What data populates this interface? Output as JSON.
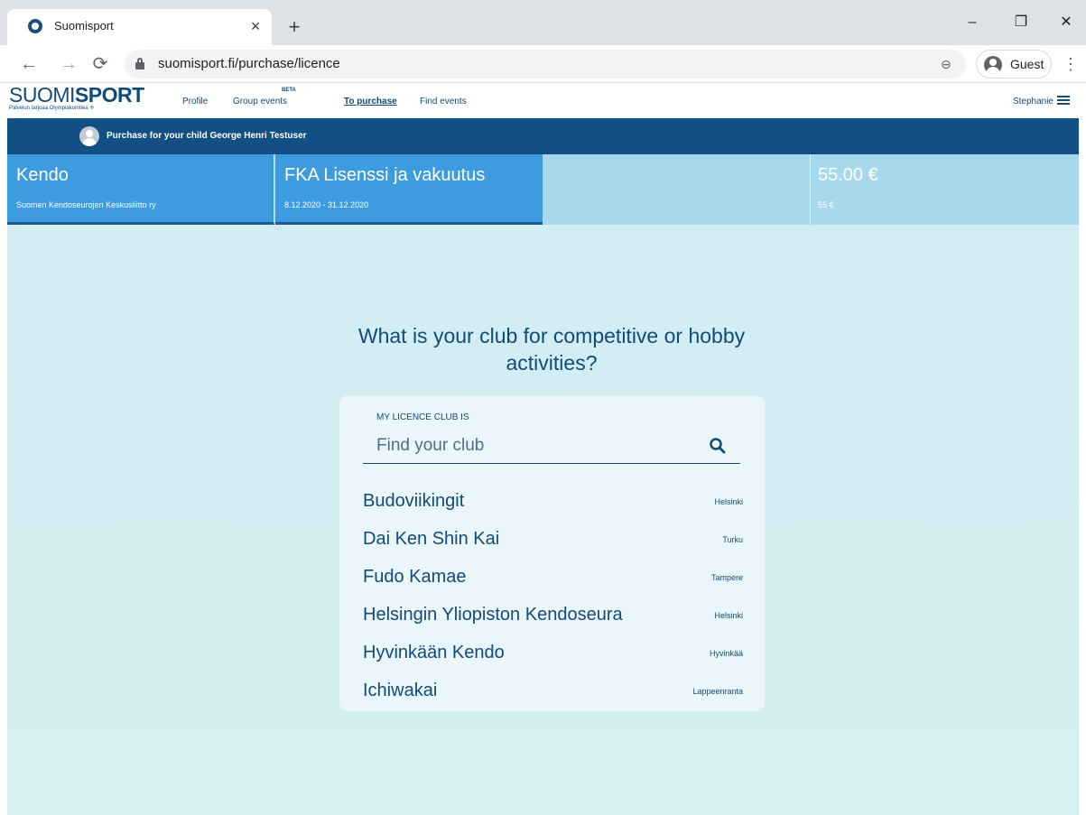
{
  "browser": {
    "tab_title": "Suomisport",
    "tab_close": "×",
    "new_tab": "+",
    "url": "suomisport.fi/purchase/licence",
    "profile_label": "Guest",
    "minimize": "–",
    "restore": "❐",
    "close": "✕",
    "back": "←",
    "forward": "→",
    "reload": "⟳",
    "menu": "⋮",
    "zoom_symbol": "⊖"
  },
  "site": {
    "logo_light": "SUOMI",
    "logo_bold": "SPORT",
    "logo_tagline": "Palvelun tarjoaa Olympiakomitea",
    "nav": {
      "profile": "Profile",
      "group_events": "Group events",
      "beta_badge": "BETA",
      "to_purchase": "To purchase",
      "find_events": "Find events"
    },
    "user_name": "Stephanie"
  },
  "child_bar": {
    "text": "Purchase for your child George Henri Testuser"
  },
  "summary": {
    "sport": "Kendo",
    "federation": "Suomen Kendoseurojen Keskusliitto ry",
    "licence": "FKA Lisenssi ja vakuutus",
    "period": "8.12.2020 - 31.12.2020",
    "price": "55.00 €",
    "price_small": "55 €"
  },
  "question": "What is your club for competitive or hobby activities?",
  "club_search": {
    "label": "MY LICENCE CLUB IS",
    "placeholder": "Find your club"
  },
  "clubs": [
    {
      "name": "Budoviikingit",
      "city": "Helsinki"
    },
    {
      "name": "Dai Ken Shin Kai",
      "city": "Turku"
    },
    {
      "name": "Fudo Kamae",
      "city": "Tampere"
    },
    {
      "name": "Helsingin Yliopiston Kendoseura",
      "city": "Helsinki"
    },
    {
      "name": "Hyvinkään Kendo",
      "city": "Hyvinkää"
    },
    {
      "name": "Ichiwakai",
      "city": "Lappeenranta"
    }
  ],
  "colors": {
    "brand_dark": "#124a78",
    "panel_blue": "#3d9be0",
    "child_bar": "#124f84"
  }
}
